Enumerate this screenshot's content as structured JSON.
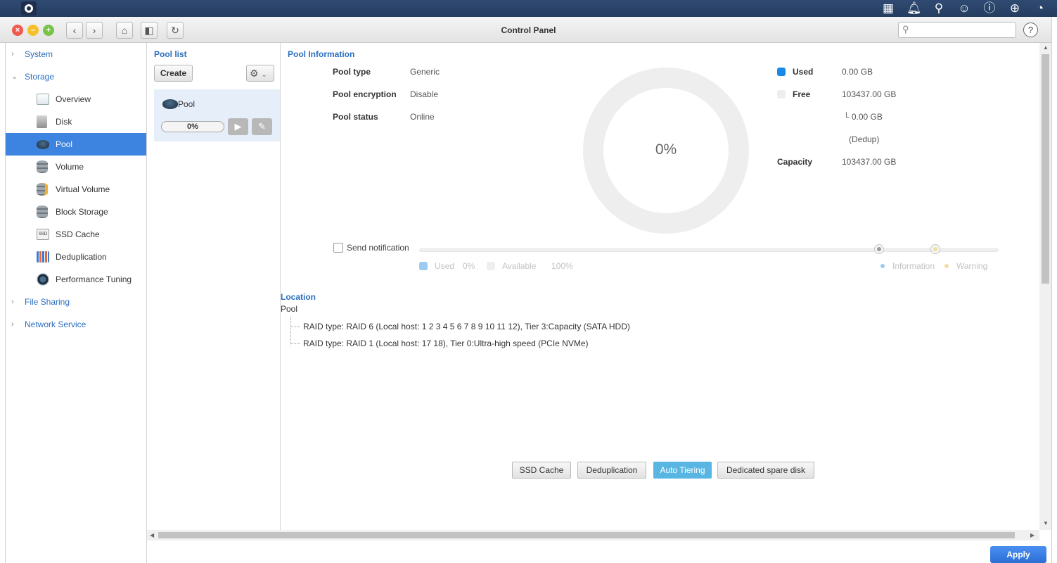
{
  "window": {
    "title": "Control Panel"
  },
  "topbar": {
    "icons": [
      "apps-grid-icon",
      "bell-icon",
      "search-icon",
      "user-icon",
      "help-icon",
      "globe-icon",
      "dashboard-gauge-icon"
    ]
  },
  "titlebar": {
    "nav_back": "‹",
    "nav_forward": "›",
    "search_placeholder": "",
    "help": "?"
  },
  "sidebar": {
    "categories": [
      {
        "label": "System"
      },
      {
        "label": "Storage"
      },
      {
        "label": "File Sharing"
      },
      {
        "label": "Network Service"
      }
    ],
    "items": [
      {
        "label": "Overview"
      },
      {
        "label": "Disk"
      },
      {
        "label": "Pool"
      },
      {
        "label": "Volume"
      },
      {
        "label": "Virtual Volume"
      },
      {
        "label": "Block Storage"
      },
      {
        "label": "SSD Cache"
      },
      {
        "label": "Deduplication"
      },
      {
        "label": "Performance Tuning"
      }
    ],
    "active_item": "Pool"
  },
  "pool_list": {
    "title": "Pool list",
    "create_label": "Create",
    "entries": [
      {
        "name": "Pool",
        "usage_label": "0%",
        "usage_fraction": 0
      }
    ]
  },
  "pool_info": {
    "title": "Pool Information",
    "rows": [
      {
        "label": "Pool type",
        "value": "Generic"
      },
      {
        "label": "Pool encryption",
        "value": "Disable"
      },
      {
        "label": "Pool status",
        "value": "Online"
      }
    ],
    "donut_label": "0%",
    "legend": [
      {
        "label": "Used",
        "value": "0.00 GB",
        "color": "#1a88e6"
      },
      {
        "label": "Free",
        "value": "103437.00 GB",
        "color": "#eeeeee"
      }
    ],
    "dedup_line": "└ 0.00 GB",
    "dedup_note": "(Dedup)",
    "capacity_label": "Capacity",
    "capacity_value": "103437.00 GB"
  },
  "notification": {
    "checkbox_label": "Send notification",
    "checked": false,
    "legend": {
      "used_label": "Used",
      "used_value": "0%",
      "available_label": "Available",
      "available_value": "100%",
      "information_label": "Information",
      "warning_label": "Warning"
    },
    "colors": {
      "used": "#9ccaf0",
      "information": "#9ccaf0",
      "warning": "#f5dca4"
    }
  },
  "location": {
    "title": "Location",
    "pool": "Pool",
    "raids": [
      "RAID type: RAID 6 (Local host: 1 2 3 4 5 6 7 8 9 10 11 12), Tier 3:Capacity (SATA HDD)",
      "RAID type: RAID 1 (Local host: 17 18), Tier 0:Ultra-high speed (PCIe NVMe)"
    ]
  },
  "tabs": [
    {
      "label": "SSD Cache",
      "active": false
    },
    {
      "label": "Deduplication",
      "active": false
    },
    {
      "label": "Auto Tiering",
      "active": true
    },
    {
      "label": "Dedicated spare disk",
      "active": false
    }
  ],
  "footer": {
    "apply_label": "Apply"
  }
}
